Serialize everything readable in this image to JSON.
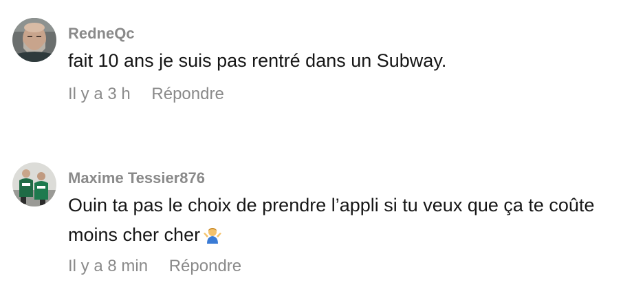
{
  "comments": [
    {
      "username": "RedneQc",
      "text": "fait 10 ans je suis pas rentré dans un Subway.",
      "time": "Il y a 3 h",
      "reply_label": "Répondre",
      "avatar_icon": "user-avatar-bald-man"
    },
    {
      "username": "Maxime Tessier876",
      "text": "Ouin ta pas le choix de prendre l’appli si tu veux que ça te coûte moins cher cher",
      "emoji": "person-shrugging-emoji",
      "time": "Il y a 8 min",
      "reply_label": "Répondre",
      "avatar_icon": "user-avatar-two-people"
    }
  ],
  "colors": {
    "username": "#8a8a8a",
    "text": "#161616",
    "meta": "#8a8a8a",
    "background": "#ffffff"
  }
}
